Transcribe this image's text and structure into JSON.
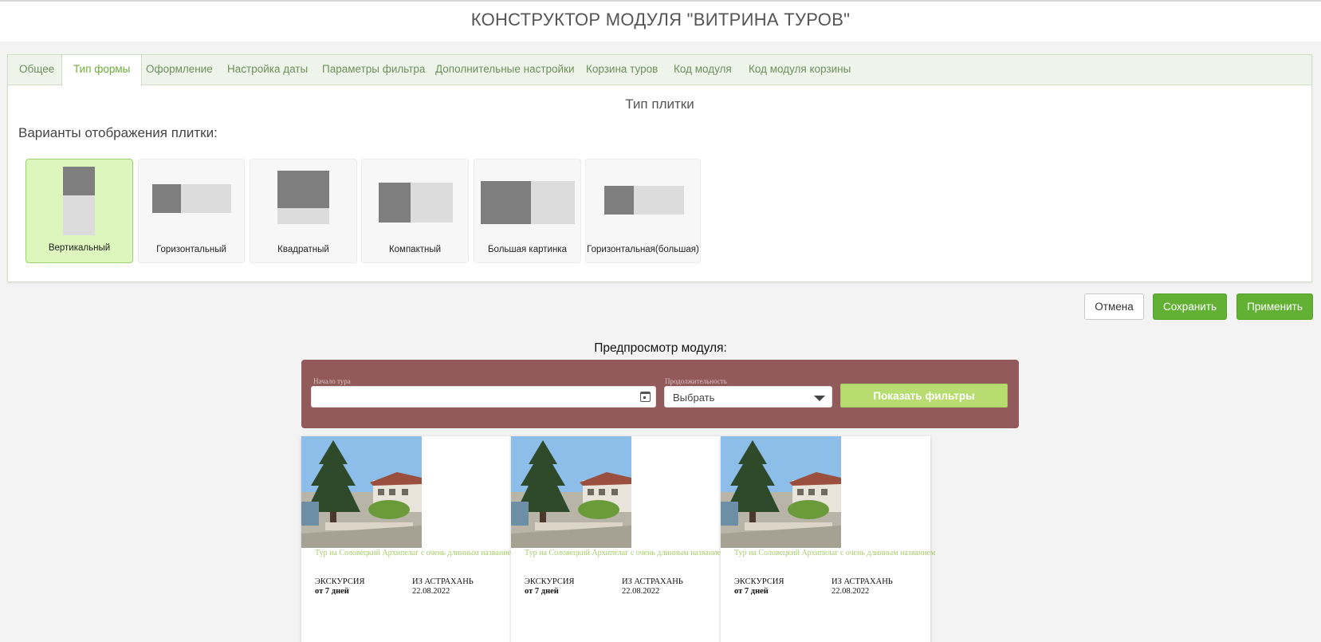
{
  "page": {
    "title": "КОНСТРУКТОР МОДУЛЯ \"ВИТРИНА ТУРОВ\""
  },
  "tabs": [
    {
      "label": "Общее",
      "active": false
    },
    {
      "label": "Тип формы",
      "active": true
    },
    {
      "label": "Оформление",
      "active": false
    },
    {
      "label": "Настройка даты",
      "active": false
    },
    {
      "label": "Параметры фильтра",
      "active": false
    },
    {
      "label": "Дополнительные настройки",
      "active": false
    },
    {
      "label": "Корзина туров",
      "active": false
    },
    {
      "label": "Код модуля",
      "active": false
    },
    {
      "label": "Код модуля корзины",
      "active": false
    }
  ],
  "section": {
    "title": "Тип плитки",
    "variants_label": "Варианты отображения плитки:",
    "variants": [
      {
        "label": "Вертикальный",
        "selected": true
      },
      {
        "label": "Горизонтальный",
        "selected": false
      },
      {
        "label": "Квадратный",
        "selected": false
      },
      {
        "label": "Компактный",
        "selected": false
      },
      {
        "label": "Большая картинка",
        "selected": false
      },
      {
        "label": "Горизонтальная(большая)",
        "selected": false
      }
    ]
  },
  "actions": {
    "cancel": "Отмена",
    "save": "Сохранить",
    "apply": "Применить"
  },
  "preview": {
    "title": "Предпросмотр модуля:",
    "filter": {
      "start_caption": "Начало тура",
      "start_value": "",
      "duration_caption": "Продолжительность",
      "duration_value": "Выбрать",
      "show_filters": "Показать фильтры"
    },
    "cards": [
      {
        "title": "Тур на Соловецкий Архипелаг с очень длинным названием",
        "type": "ЭКСКУРСИЯ",
        "duration": "от 7 дней",
        "from": "ИЗ АСТРАХАНЬ",
        "date": "22.08.2022"
      },
      {
        "title": "Тур на Соловецкий Архипелаг с очень длинным названием",
        "type": "ЭКСКУРСИЯ",
        "duration": "от 7 дней",
        "from": "ИЗ АСТРАХАНЬ",
        "date": "22.08.2022"
      },
      {
        "title": "Тур на Соловецкий Архипелаг с очень длинным названием",
        "type": "ЭКСКУРСИЯ",
        "duration": "от 7 дней",
        "from": "ИЗ АСТРАХАНЬ",
        "date": "22.08.2022"
      }
    ]
  },
  "colors": {
    "accent_green": "#62b034",
    "tab_active": "#6fae3b",
    "filter_bg": "#925a5a",
    "show_filters_bg": "#b8dc70",
    "selected_variant_bg": "#dcf6bd",
    "card_title": "#a8cd6b"
  }
}
